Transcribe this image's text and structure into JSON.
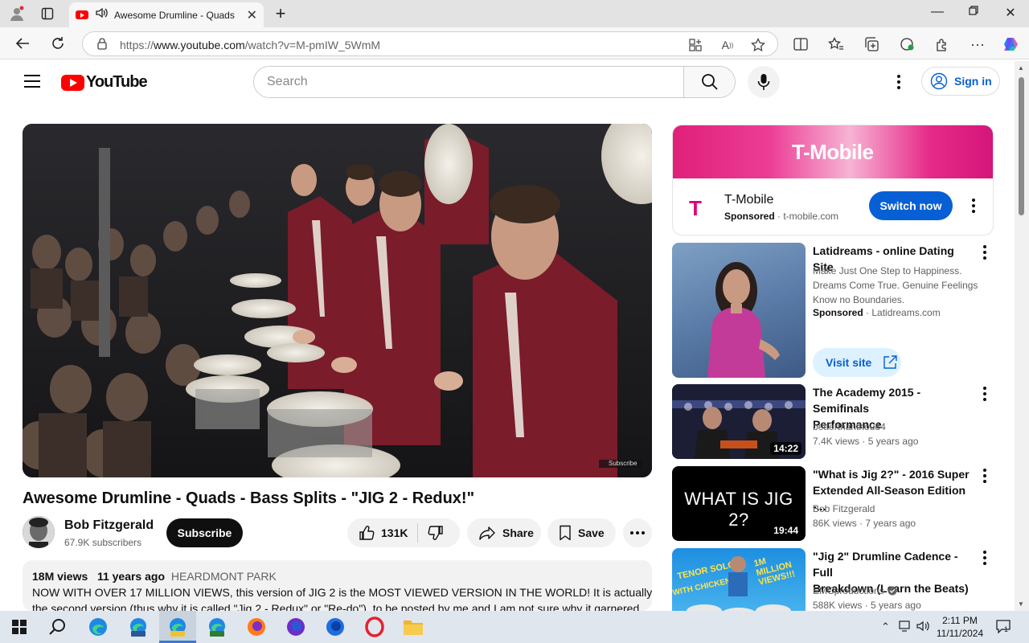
{
  "browser": {
    "tab_title": "Awesome Drumline - Quads - Bass Splits",
    "url_prefix": "https://",
    "url_host": "www.youtube.com",
    "url_path": "/watch?v=M-pmIW_5WmM"
  },
  "header": {
    "logo_text": "YouTube",
    "search_placeholder": "Search",
    "sign_in": "Sign in"
  },
  "video": {
    "title": "Awesome Drumline - Quads - Bass Splits - \"JIG 2 - Redux!\"",
    "channel": "Bob Fitzgerald",
    "subscribers": "67.9K subscribers",
    "subscribe_label": "Subscribe",
    "likes": "131K",
    "share_label": "Share",
    "save_label": "Save",
    "watermark": "Subscribe",
    "views": "18M views",
    "age": "11 years ago",
    "location_tag": "HEARDMONT PARK",
    "description_line1": "NOW WITH OVER 17 MILLION VIEWS, this version of JIG 2 is the MOST VIEWED VERSION IN THE WORLD!  It is actually",
    "description_line2": "the second version (thus why it is called \"Jig 2 - Redux\" or \"Re-do\"), to be posted by me and I am not sure why it garnered"
  },
  "ad_tmobile": {
    "banner_brand": "T-Mobile",
    "logo_letter": "T",
    "name": "T-Mobile",
    "sponsored": "Sponsored",
    "domain": "t-mobile.com",
    "cta": "Switch now"
  },
  "ad_dating": {
    "title": "Latidreams - online Dating Site",
    "line1": "Make Just One Step to Happiness.",
    "line2": "Dreams Come True. Genuine Feelings",
    "line3": "Know no Boundaries.",
    "sponsored": "Sponsored",
    "domain": "Latidreams.com",
    "cta": "Visit site"
  },
  "recommendations": [
    {
      "title_line1": "The Academy 2015 - Semifinals",
      "title_line2": "Performance",
      "channel": "betterthanthou84",
      "views": "7.4K views",
      "age": "5 years ago",
      "duration": "14:22"
    },
    {
      "title_line1": "\"What is Jig 2?\" - 2016 Super",
      "title_line2": "Extended All-Season Edition -...",
      "channel": "Bob Fitzgerald",
      "views": "86K views",
      "age": "7 years ago",
      "duration": "19:44",
      "thumb_text": "WHAT IS JIG 2?"
    },
    {
      "title_line1": "\"Jig 2\" Drumline Cadence - Full",
      "title_line2": "Breakdown (Learn the Beats)",
      "channel": "EMCproductions",
      "views": "588K views",
      "age": "5 years ago",
      "thumb_text_a": "TENOR SOLO",
      "thumb_text_b": "WITH CHICKENS!",
      "thumb_text_c": "1M MILLION VIEWS!!!"
    }
  ],
  "taskbar": {
    "time": "2:11 PM",
    "date": "11/11/2024",
    "notification_count": "1"
  }
}
